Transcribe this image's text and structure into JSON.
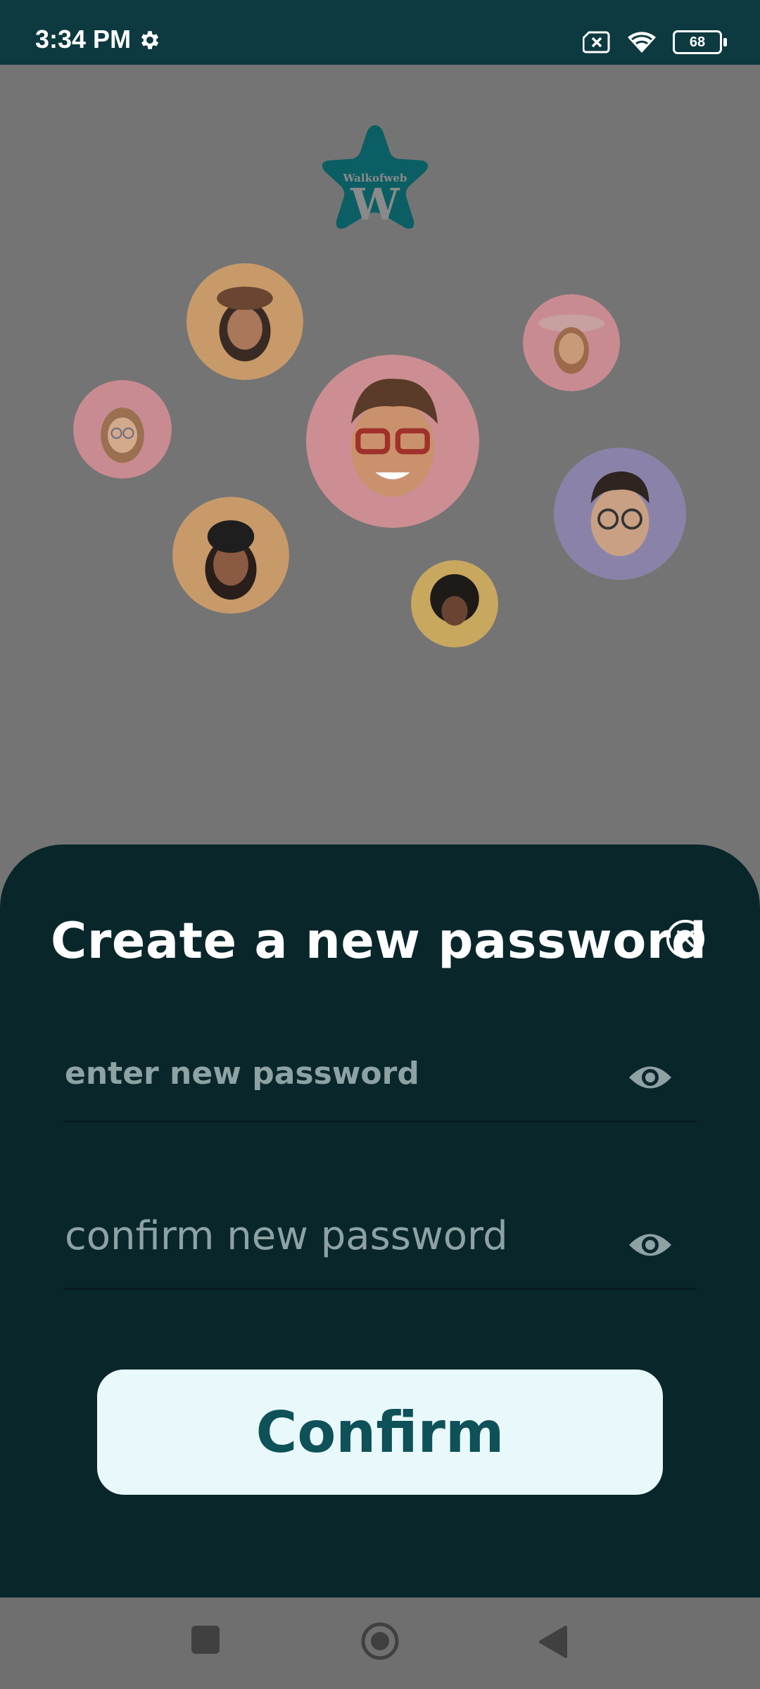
{
  "status_bar": {
    "time": "3:34 PM",
    "battery_level": "68",
    "icons": [
      "settings-gear-icon",
      "no-sim-icon",
      "wifi-icon",
      "battery-icon"
    ]
  },
  "background": {
    "logo_text": "Walkofweb",
    "logo_letter": "W",
    "brand_colors": {
      "teal": "#0b5e63",
      "dark": "#09262b",
      "status": "#0c3a40"
    },
    "avatars": [
      {
        "name": "avatar-beret-woman",
        "bg": "#c89a6a"
      },
      {
        "name": "avatar-cowgirl",
        "bg": "#c98b92"
      },
      {
        "name": "avatar-glasses-woman",
        "bg": "#c98b92"
      },
      {
        "name": "avatar-main-man",
        "bg": "#cc8e93"
      },
      {
        "name": "avatar-beanie-woman",
        "bg": "#c89a6a"
      },
      {
        "name": "avatar-glasses-man",
        "bg": "#8a82a8"
      },
      {
        "name": "avatar-curly",
        "bg": "#c8a75f"
      }
    ]
  },
  "sheet": {
    "title": "Create a new password",
    "new_password_placeholder": "enter new password",
    "confirm_password_placeholder": "confirm new password",
    "confirm_label": "Confirm"
  },
  "nav_bar": {
    "icons": [
      "recent-apps-icon",
      "home-icon",
      "back-icon"
    ]
  }
}
